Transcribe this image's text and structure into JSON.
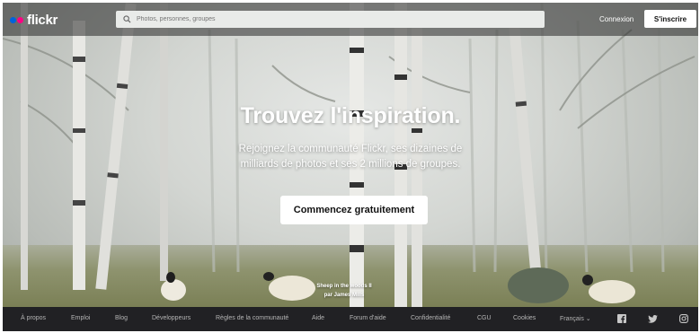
{
  "header": {
    "logo_text": "flickr",
    "search": {
      "placeholder": "Photos, personnes, groupes",
      "value": ""
    },
    "login_label": "Connexion",
    "signup_label": "S'inscrire"
  },
  "hero": {
    "title": "Trouvez l'inspiration.",
    "subtitle_line1": "Rejoignez la communauté Flickr, ses dizaines de",
    "subtitle_line2": "milliards de photos et ses 2 millions de groupes.",
    "cta_label": "Commencez gratuitement",
    "photo_title": "Sheep in the woods II",
    "photo_author": "par James Mills"
  },
  "footer": {
    "links": [
      "À propos",
      "Emploi",
      "Blog",
      "Développeurs",
      "Règles de la communauté",
      "Aide",
      "Forum d'aide",
      "Confidentialité",
      "CGU",
      "Cookies"
    ],
    "language": "Français ⌄",
    "social_icons": [
      "facebook-icon",
      "twitter-icon",
      "instagram-icon"
    ]
  },
  "colors": {
    "flickr_blue": "#0063dc",
    "flickr_pink": "#ff0084",
    "footer_bg": "#212124"
  }
}
